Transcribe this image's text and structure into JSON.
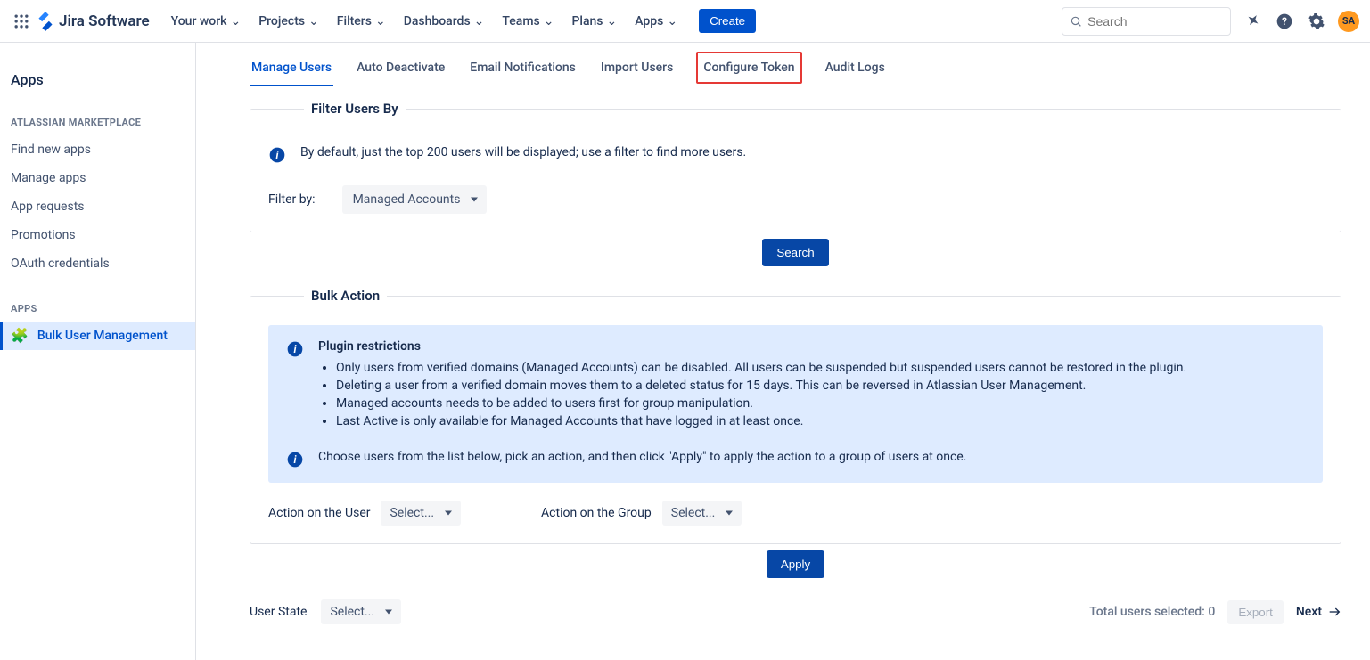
{
  "topbar": {
    "product": "Jira Software",
    "nav": [
      "Your work",
      "Projects",
      "Filters",
      "Dashboards",
      "Teams",
      "Plans",
      "Apps"
    ],
    "create": "Create",
    "search_placeholder": "Search",
    "avatar_initials": "SA"
  },
  "sidebar": {
    "title": "Apps",
    "section1_label": "ATLASSIAN MARKETPLACE",
    "items1": [
      "Find new apps",
      "Manage apps",
      "App requests",
      "Promotions",
      "OAuth credentials"
    ],
    "section2_label": "APPS",
    "active_item": "Bulk User Management"
  },
  "tabs": [
    "Manage Users",
    "Auto Deactivate",
    "Email Notifications",
    "Import Users",
    "Configure Token",
    "Audit Logs"
  ],
  "filter_panel": {
    "legend": "Filter Users By",
    "info": "By default, just the top 200 users will be displayed; use a filter to find more users.",
    "filter_by_label": "Filter by:",
    "filter_by_value": "Managed Accounts",
    "search_btn": "Search"
  },
  "bulk_panel": {
    "legend": "Bulk Action",
    "restrictions_title": "Plugin restrictions",
    "restrictions": [
      "Only users from verified domains (Managed Accounts) can be disabled. All users can be suspended but suspended users cannot be restored in the plugin.",
      "Deleting a user from a verified domain moves them to a deleted status for 15 days. This can be reversed in Atlassian User Management.",
      "Managed accounts needs to be added to users first for group manipulation.",
      "Last Active is only available for Managed Accounts that have logged in at least once."
    ],
    "choose_info": "Choose users from the list below, pick an action, and then click \"Apply\" to apply the action to a group of users at once.",
    "action_user_label": "Action on the User",
    "action_user_value": "Select...",
    "action_group_label": "Action on the Group",
    "action_group_value": "Select...",
    "apply_btn": "Apply"
  },
  "footer": {
    "user_state_label": "User State",
    "user_state_value": "Select...",
    "total_selected_label": "Total users selected:",
    "total_selected_count": "0",
    "export_btn": "Export",
    "next_btn": "Next"
  }
}
